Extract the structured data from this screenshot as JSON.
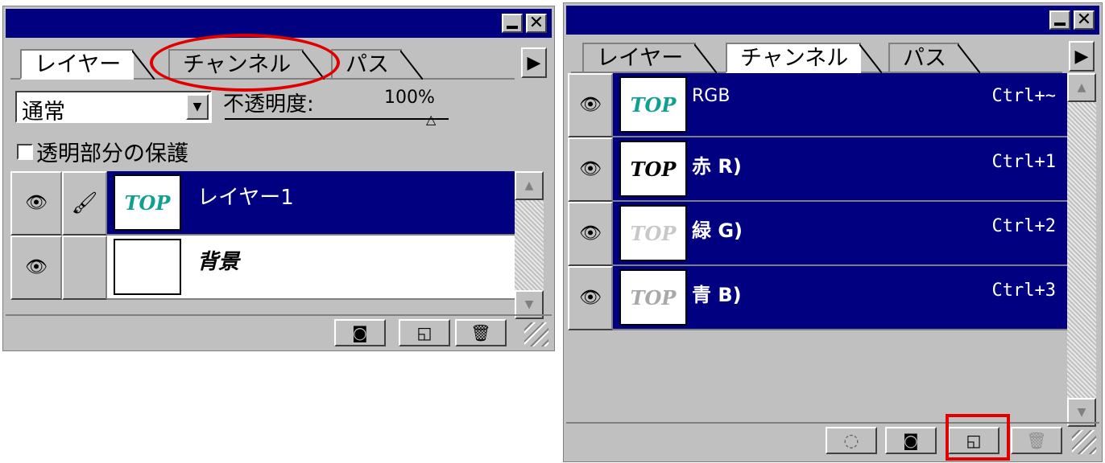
{
  "layers_panel": {
    "tabs": [
      "レイヤー",
      "チャンネル",
      "パス"
    ],
    "blend_mode": "通常",
    "opacity_label": "不透明度:",
    "opacity_value": "100%",
    "preserve_transparency": "透明部分の保護",
    "layers": [
      {
        "name": "レイヤー1",
        "thumb": "TOP",
        "selected": true
      },
      {
        "name": "背景",
        "thumb": "",
        "selected": false
      }
    ]
  },
  "channels_panel": {
    "tabs": [
      "レイヤー",
      "チャンネル",
      "パス"
    ],
    "channels": [
      {
        "name": "RGB",
        "thumb": "TOP",
        "shortcut": "Ctrl+~",
        "thumb_color": "#008080"
      },
      {
        "name": "赤 R)",
        "thumb": "TOP",
        "shortcut": "Ctrl+1",
        "thumb_color": "#000000"
      },
      {
        "name": "緑 G)",
        "thumb": "TOP",
        "shortcut": "Ctrl+2",
        "thumb_color": "#c0c0c0"
      },
      {
        "name": "青 B)",
        "thumb": "TOP",
        "shortcut": "Ctrl+3",
        "thumb_color": "#a0a0a0"
      }
    ]
  },
  "colors": {
    "selection": "#000080",
    "highlight": "#e00000",
    "panel": "#c0c0c0"
  }
}
